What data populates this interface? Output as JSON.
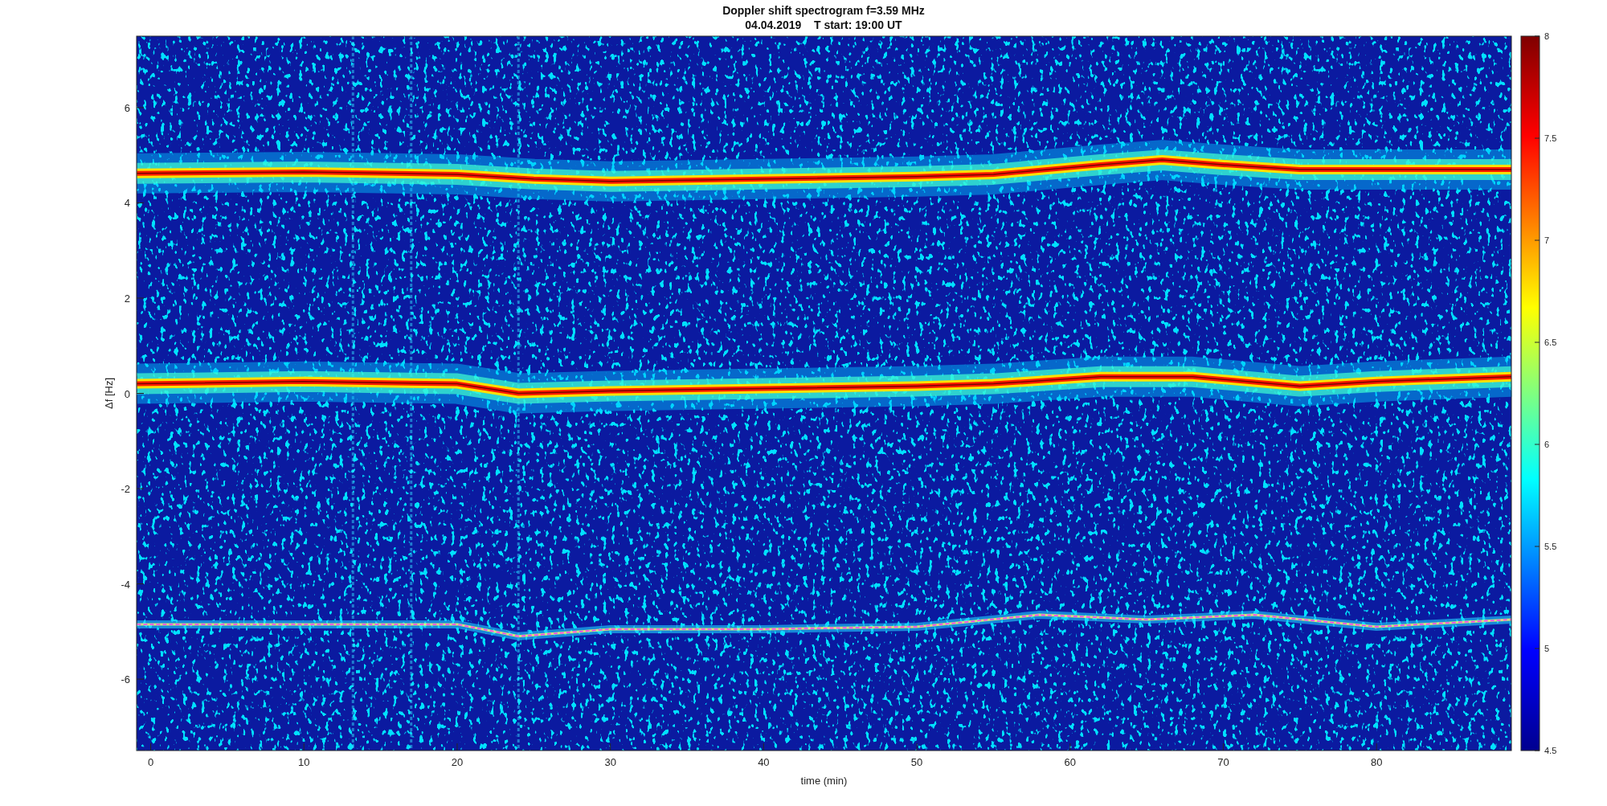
{
  "title": [
    "Doppler shift spectrogram f=3.59 MHz",
    "04.04.2019    T start: 19:00 UT"
  ],
  "plot": {
    "xlabel": "time (min)",
    "ylabel": "Δf [Hz]",
    "xticks": [
      "0",
      "10",
      "20",
      "30",
      "40",
      "50",
      "60",
      "70",
      "80"
    ],
    "yticks": [
      "6",
      "4",
      "2",
      "0",
      "-2",
      "-4",
      "-6"
    ],
    "colorbar": {
      "ticks": [
        "8",
        "7.5",
        "7",
        "6.5",
        "6",
        "5.5",
        "5",
        "4.5"
      ]
    }
  }
}
